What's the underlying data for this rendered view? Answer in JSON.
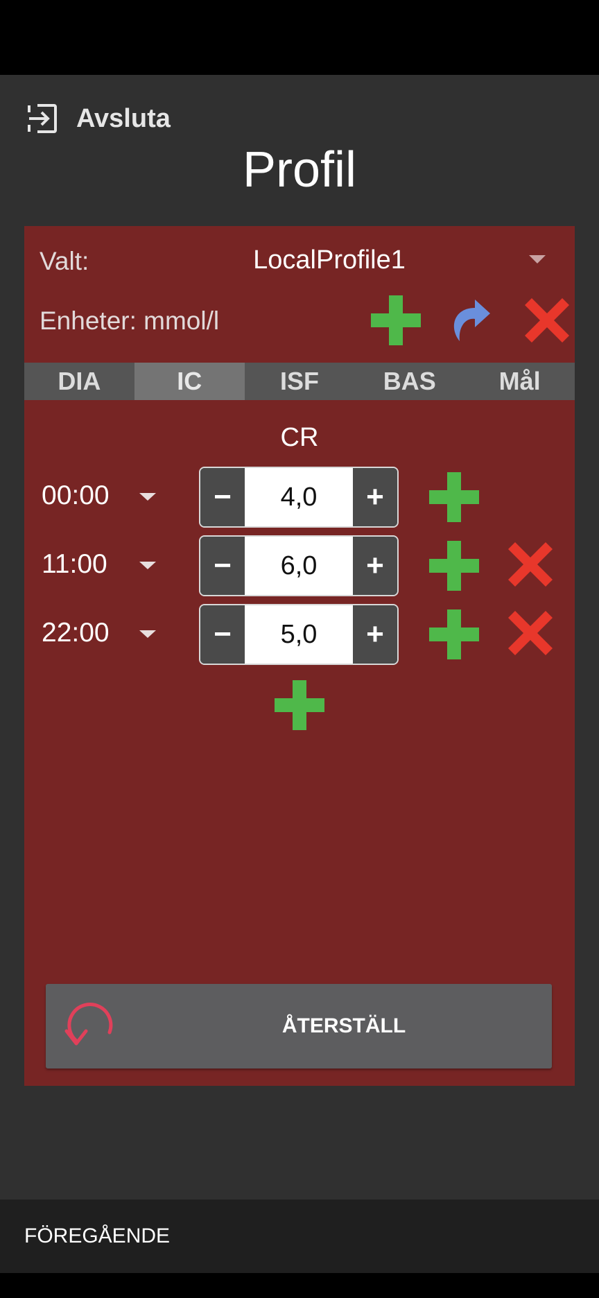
{
  "header": {
    "exit_label": "Avsluta",
    "title": "Profil"
  },
  "profile": {
    "selected_label": "Valt:",
    "selected_value": "LocalProfile1",
    "units_text": "Enheter: mmol/l"
  },
  "tabs": [
    {
      "label": "DIA"
    },
    {
      "label": "IC",
      "active": true
    },
    {
      "label": "ISF"
    },
    {
      "label": "BAS"
    },
    {
      "label": "Mål"
    }
  ],
  "ic": {
    "title": "CR",
    "rows": [
      {
        "time": "00:00",
        "value": "4,0",
        "minus": "−",
        "plus": "+",
        "deletable": false
      },
      {
        "time": "11:00",
        "value": "6,0",
        "minus": "−",
        "plus": "+",
        "deletable": true
      },
      {
        "time": "22:00",
        "value": "5,0",
        "minus": "−",
        "plus": "+",
        "deletable": true
      }
    ]
  },
  "actions": {
    "reset_label": "ÅTERSTÄLL",
    "previous_label": "FÖREGÅENDE"
  },
  "colors": {
    "panel": "#772524",
    "add_green": "#4fb84a",
    "delete_red": "#e8372b",
    "clone_blue": "#6a8fdc",
    "reset_icon": "#e0405a"
  },
  "icons": [
    "exit-icon",
    "add-icon",
    "clone-icon",
    "delete-icon",
    "undo-icon",
    "dropdown-caret-icon"
  ]
}
